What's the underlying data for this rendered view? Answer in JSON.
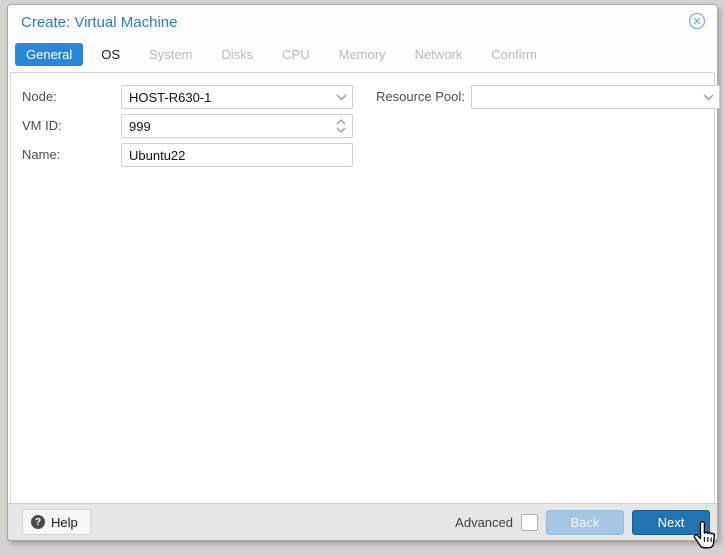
{
  "dialog": {
    "title": "Create: Virtual Machine",
    "close_icon": "circled-x"
  },
  "tabs": {
    "items": [
      {
        "label": "General",
        "state": "active"
      },
      {
        "label": "OS",
        "state": "enabled"
      },
      {
        "label": "System",
        "state": "disabled"
      },
      {
        "label": "Disks",
        "state": "disabled"
      },
      {
        "label": "CPU",
        "state": "disabled"
      },
      {
        "label": "Memory",
        "state": "disabled"
      },
      {
        "label": "Network",
        "state": "disabled"
      },
      {
        "label": "Confirm",
        "state": "disabled"
      }
    ]
  },
  "form": {
    "node": {
      "label": "Node:",
      "value": "HOST-R630-1",
      "control": "combobox"
    },
    "vmid": {
      "label": "VM ID:",
      "value": "999",
      "control": "number-spinner"
    },
    "name": {
      "label": "Name:",
      "value": "Ubuntu22",
      "control": "text"
    },
    "resource_pool": {
      "label": "Resource Pool:",
      "value": "",
      "control": "combobox"
    }
  },
  "footer": {
    "help_label": "Help",
    "help_icon_glyph": "?",
    "advanced_label": "Advanced",
    "advanced_checked": false,
    "back_label": "Back",
    "back_disabled": true,
    "next_label": "Next"
  },
  "colors": {
    "title_blue": "#2e7cc3",
    "active_tab_blue": "#2b86d5",
    "next_button_blue": "#2173b2",
    "back_button_disabled_blue": "#a4c7e3",
    "disabled_tab_gray": "#bcbcbc",
    "footer_gray": "#e6e6e6"
  }
}
